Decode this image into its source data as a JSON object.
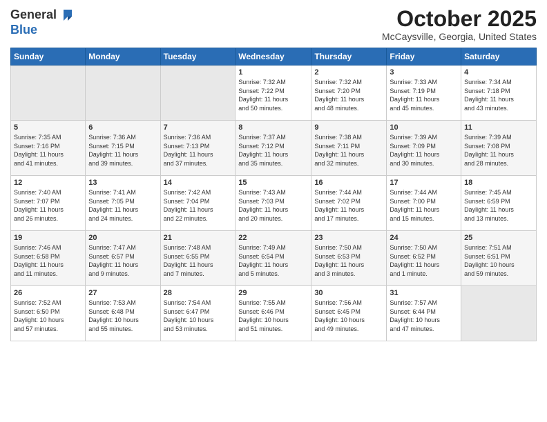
{
  "header": {
    "logo_general": "General",
    "logo_blue": "Blue",
    "month_title": "October 2025",
    "location": "McCaysville, Georgia, United States"
  },
  "days_of_week": [
    "Sunday",
    "Monday",
    "Tuesday",
    "Wednesday",
    "Thursday",
    "Friday",
    "Saturday"
  ],
  "weeks": [
    [
      {
        "num": "",
        "info": ""
      },
      {
        "num": "",
        "info": ""
      },
      {
        "num": "",
        "info": ""
      },
      {
        "num": "1",
        "info": "Sunrise: 7:32 AM\nSunset: 7:22 PM\nDaylight: 11 hours\nand 50 minutes."
      },
      {
        "num": "2",
        "info": "Sunrise: 7:32 AM\nSunset: 7:20 PM\nDaylight: 11 hours\nand 48 minutes."
      },
      {
        "num": "3",
        "info": "Sunrise: 7:33 AM\nSunset: 7:19 PM\nDaylight: 11 hours\nand 45 minutes."
      },
      {
        "num": "4",
        "info": "Sunrise: 7:34 AM\nSunset: 7:18 PM\nDaylight: 11 hours\nand 43 minutes."
      }
    ],
    [
      {
        "num": "5",
        "info": "Sunrise: 7:35 AM\nSunset: 7:16 PM\nDaylight: 11 hours\nand 41 minutes."
      },
      {
        "num": "6",
        "info": "Sunrise: 7:36 AM\nSunset: 7:15 PM\nDaylight: 11 hours\nand 39 minutes."
      },
      {
        "num": "7",
        "info": "Sunrise: 7:36 AM\nSunset: 7:13 PM\nDaylight: 11 hours\nand 37 minutes."
      },
      {
        "num": "8",
        "info": "Sunrise: 7:37 AM\nSunset: 7:12 PM\nDaylight: 11 hours\nand 35 minutes."
      },
      {
        "num": "9",
        "info": "Sunrise: 7:38 AM\nSunset: 7:11 PM\nDaylight: 11 hours\nand 32 minutes."
      },
      {
        "num": "10",
        "info": "Sunrise: 7:39 AM\nSunset: 7:09 PM\nDaylight: 11 hours\nand 30 minutes."
      },
      {
        "num": "11",
        "info": "Sunrise: 7:39 AM\nSunset: 7:08 PM\nDaylight: 11 hours\nand 28 minutes."
      }
    ],
    [
      {
        "num": "12",
        "info": "Sunrise: 7:40 AM\nSunset: 7:07 PM\nDaylight: 11 hours\nand 26 minutes."
      },
      {
        "num": "13",
        "info": "Sunrise: 7:41 AM\nSunset: 7:05 PM\nDaylight: 11 hours\nand 24 minutes."
      },
      {
        "num": "14",
        "info": "Sunrise: 7:42 AM\nSunset: 7:04 PM\nDaylight: 11 hours\nand 22 minutes."
      },
      {
        "num": "15",
        "info": "Sunrise: 7:43 AM\nSunset: 7:03 PM\nDaylight: 11 hours\nand 20 minutes."
      },
      {
        "num": "16",
        "info": "Sunrise: 7:44 AM\nSunset: 7:02 PM\nDaylight: 11 hours\nand 17 minutes."
      },
      {
        "num": "17",
        "info": "Sunrise: 7:44 AM\nSunset: 7:00 PM\nDaylight: 11 hours\nand 15 minutes."
      },
      {
        "num": "18",
        "info": "Sunrise: 7:45 AM\nSunset: 6:59 PM\nDaylight: 11 hours\nand 13 minutes."
      }
    ],
    [
      {
        "num": "19",
        "info": "Sunrise: 7:46 AM\nSunset: 6:58 PM\nDaylight: 11 hours\nand 11 minutes."
      },
      {
        "num": "20",
        "info": "Sunrise: 7:47 AM\nSunset: 6:57 PM\nDaylight: 11 hours\nand 9 minutes."
      },
      {
        "num": "21",
        "info": "Sunrise: 7:48 AM\nSunset: 6:55 PM\nDaylight: 11 hours\nand 7 minutes."
      },
      {
        "num": "22",
        "info": "Sunrise: 7:49 AM\nSunset: 6:54 PM\nDaylight: 11 hours\nand 5 minutes."
      },
      {
        "num": "23",
        "info": "Sunrise: 7:50 AM\nSunset: 6:53 PM\nDaylight: 11 hours\nand 3 minutes."
      },
      {
        "num": "24",
        "info": "Sunrise: 7:50 AM\nSunset: 6:52 PM\nDaylight: 11 hours\nand 1 minute."
      },
      {
        "num": "25",
        "info": "Sunrise: 7:51 AM\nSunset: 6:51 PM\nDaylight: 10 hours\nand 59 minutes."
      }
    ],
    [
      {
        "num": "26",
        "info": "Sunrise: 7:52 AM\nSunset: 6:50 PM\nDaylight: 10 hours\nand 57 minutes."
      },
      {
        "num": "27",
        "info": "Sunrise: 7:53 AM\nSunset: 6:48 PM\nDaylight: 10 hours\nand 55 minutes."
      },
      {
        "num": "28",
        "info": "Sunrise: 7:54 AM\nSunset: 6:47 PM\nDaylight: 10 hours\nand 53 minutes."
      },
      {
        "num": "29",
        "info": "Sunrise: 7:55 AM\nSunset: 6:46 PM\nDaylight: 10 hours\nand 51 minutes."
      },
      {
        "num": "30",
        "info": "Sunrise: 7:56 AM\nSunset: 6:45 PM\nDaylight: 10 hours\nand 49 minutes."
      },
      {
        "num": "31",
        "info": "Sunrise: 7:57 AM\nSunset: 6:44 PM\nDaylight: 10 hours\nand 47 minutes."
      },
      {
        "num": "",
        "info": ""
      }
    ]
  ]
}
